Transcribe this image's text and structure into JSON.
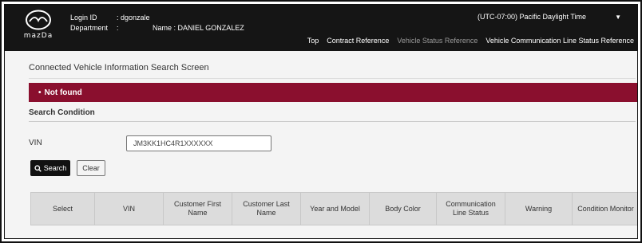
{
  "header": {
    "logo_text": "mazDa",
    "login_id_label": "Login ID",
    "login_id_value": ": dgonzale",
    "department_label": "Department",
    "department_value": ":",
    "name_label": "Name",
    "name_value": ": DANIEL GONZALEZ",
    "timezone": "(UTC-07:00) Pacific Daylight Time",
    "nav": [
      {
        "label": "Top",
        "active": true
      },
      {
        "label": "Contract Reference",
        "active": true
      },
      {
        "label": "Vehicle Status Reference",
        "active": false
      },
      {
        "label": "Vehicle Communication Line Status Reference",
        "active": true
      }
    ]
  },
  "page": {
    "title": "Connected Vehicle Information Search Screen",
    "alert": "Not found",
    "section_title": "Search Condition",
    "vin_label": "VIN",
    "vin_value": "JM3KK1HC4R1XXXXXX",
    "search_button": "Search",
    "clear_button": "Clear"
  },
  "table": {
    "columns": [
      "Select",
      "VIN",
      "Customer First Name",
      "Customer Last Name",
      "Year and Model",
      "Body Color",
      "Communication Line Status",
      "Warning",
      "Condition Monitor"
    ]
  },
  "colors": {
    "header_bg": "#151515",
    "alert_bg": "#8a0f2e",
    "table_header_bg": "#dcdcdc"
  },
  "icons": [
    "mazda-logo-icon",
    "chevron-down-icon",
    "search-icon"
  ]
}
